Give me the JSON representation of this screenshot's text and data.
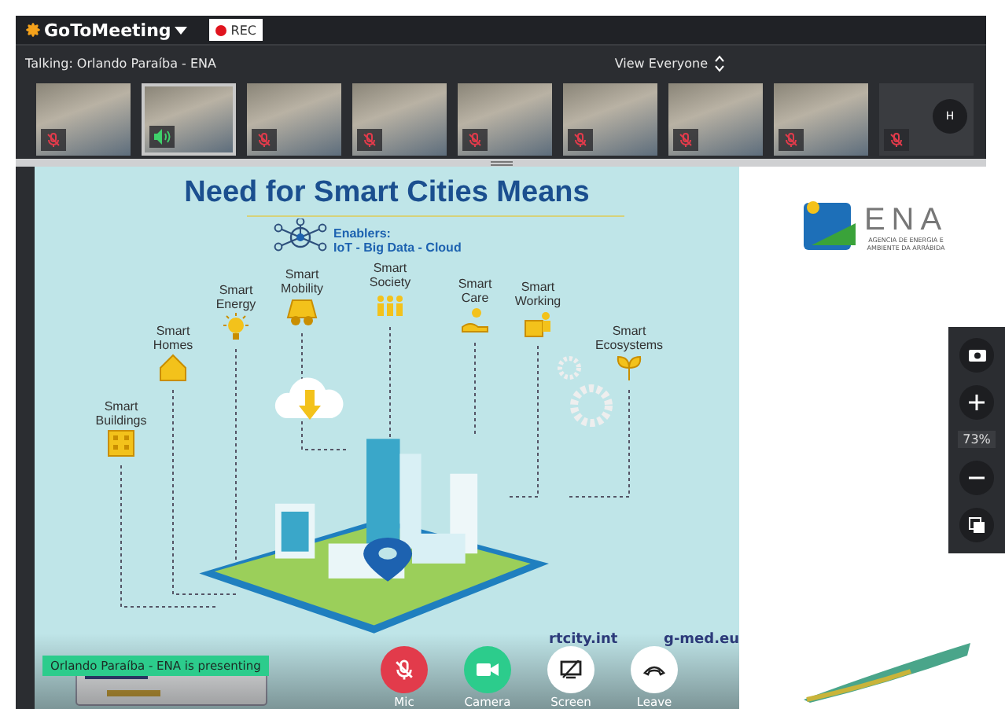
{
  "app": {
    "name": "GoToMeeting",
    "recording": "REC"
  },
  "talking": "Talking: Orlando Paraíba - ENA",
  "view": {
    "label": "View Everyone"
  },
  "participants": [
    {
      "kind": "video",
      "muted": true,
      "speaking": false
    },
    {
      "kind": "video",
      "muted": false,
      "speaking": true
    },
    {
      "kind": "video",
      "muted": true,
      "speaking": false
    },
    {
      "kind": "video",
      "muted": true,
      "speaking": false
    },
    {
      "kind": "video",
      "muted": true,
      "speaking": false
    },
    {
      "kind": "video",
      "muted": true,
      "speaking": false
    },
    {
      "kind": "video",
      "muted": true,
      "speaking": false
    },
    {
      "kind": "video",
      "muted": true,
      "speaking": false
    },
    {
      "kind": "avatar",
      "initial": "H",
      "muted": true,
      "speaking": false
    }
  ],
  "slide": {
    "title": "Need for Smart Cities Means",
    "enablers_label": "Enablers:",
    "enablers": "IoT - Big Data - Cloud",
    "items": [
      {
        "kind": "buildings",
        "label": "Smart Buildings"
      },
      {
        "kind": "homes",
        "label": "Smart Homes"
      },
      {
        "kind": "energy",
        "label": "Smart Energy"
      },
      {
        "kind": "mobility",
        "label": "Smart Mobility"
      },
      {
        "kind": "society",
        "label": "Smart Society"
      },
      {
        "kind": "care",
        "label": "Smart Care"
      },
      {
        "kind": "working",
        "label": "Smart Working"
      },
      {
        "kind": "ecosystems",
        "label": "Smart Ecosystems"
      }
    ],
    "url_parts": [
      "rtcity.int",
      "g-med.eu"
    ],
    "logo": {
      "name": "ENA",
      "subtitle": "AGENCIA DE ENERGIA E AMBIENTE DA ARRÁBIDA"
    }
  },
  "zoom": {
    "level_text": "73%"
  },
  "presenter": "Orlando Paraíba - ENA is presenting",
  "controls": [
    {
      "kind": "mic",
      "label": "Mic",
      "on": false
    },
    {
      "kind": "camera",
      "label": "Camera",
      "on": true
    },
    {
      "kind": "screen",
      "label": "Screen",
      "on": false
    },
    {
      "kind": "leave",
      "label": "Leave",
      "on": false
    }
  ]
}
